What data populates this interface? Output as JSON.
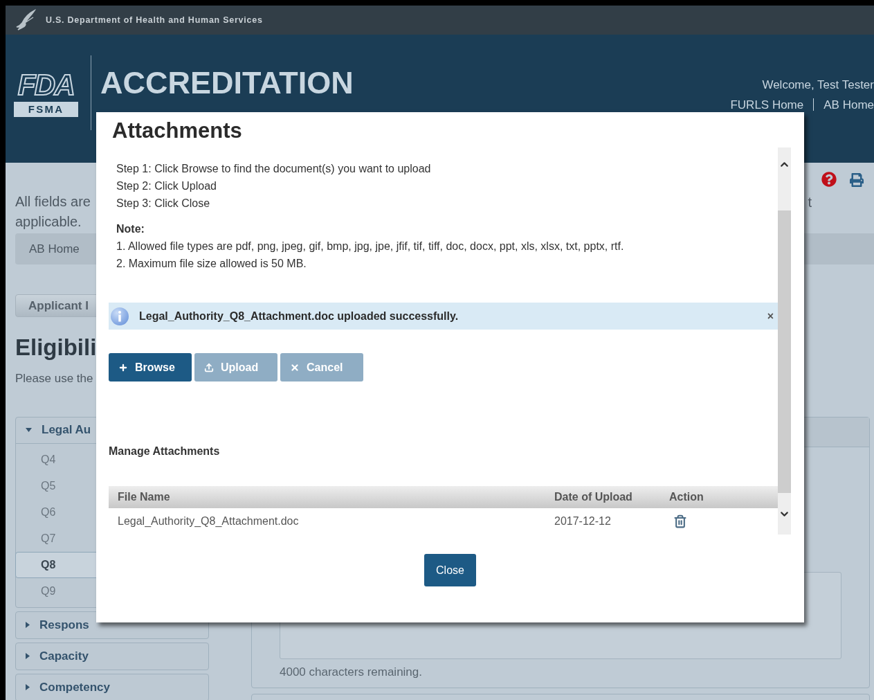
{
  "agency_bar": {
    "text": "U.S. Department of Health and Human Services"
  },
  "header": {
    "logo_letters": "FDA",
    "logo_badge": "FSMA",
    "title": "ACCREDITATION",
    "welcome": "Welcome, Test Tester",
    "links": [
      "FURLS Home",
      "AB Home"
    ]
  },
  "page": {
    "notice_lines": [
      "All fields are",
      "applicable."
    ],
    "fragment": "t",
    "breadcrumb": "AB Home",
    "tab": "Applicant I",
    "heading": "Eligibili",
    "intro": "Please use the",
    "sections": [
      {
        "label": "Legal Au",
        "expanded": true,
        "items": [
          {
            "label": "Q4",
            "selected": false
          },
          {
            "label": "Q5",
            "selected": false
          },
          {
            "label": "Q6",
            "selected": false
          },
          {
            "label": "Q7",
            "selected": false
          },
          {
            "label": "Q8",
            "selected": true
          },
          {
            "label": "Q9",
            "selected": false
          }
        ]
      },
      {
        "label": "Respons",
        "expanded": false
      },
      {
        "label": "Capacity",
        "expanded": false
      },
      {
        "label": "Competency",
        "expanded": false
      }
    ],
    "char_count": "4000 characters remaining."
  },
  "dialog": {
    "title": "Attachments",
    "steps": [
      "Step 1: Click Browse to find the document(s) you want to upload",
      "Step 2: Click Upload",
      "Step 3: Click Close"
    ],
    "note_label": "Note:",
    "notes": [
      "1. Allowed file types are pdf, png, jpeg, gif, bmp, jpg, jpe, jfif, tif, tiff, doc, docx, ppt, xls, xlsx, txt, pptx, rtf.",
      "2. Maximum file size allowed is 50 MB."
    ],
    "alert": {
      "message": "Legal_Authority_Q8_Attachment.doc uploaded successfully.",
      "close": "×"
    },
    "buttons": [
      {
        "label": "Browse",
        "kind": "add",
        "disabled": false
      },
      {
        "label": "Upload",
        "kind": "upload",
        "disabled": true
      },
      {
        "label": "Cancel",
        "kind": "cancel",
        "disabled": true
      }
    ],
    "manage_title": "Manage Attachments",
    "table": {
      "columns": [
        "File Name",
        "Date of Upload",
        "Action"
      ],
      "rows": [
        {
          "file_name": "Legal_Authority_Q8_Attachment.doc",
          "date": "2017-12-12"
        }
      ]
    },
    "close_button": "Close"
  }
}
